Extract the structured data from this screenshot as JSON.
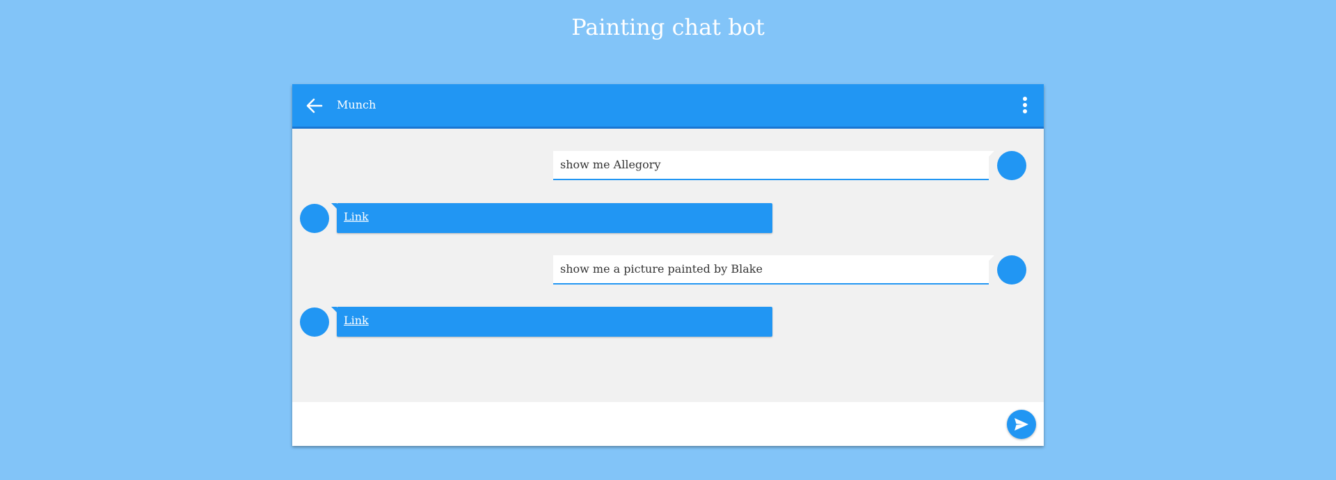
{
  "page": {
    "title": "Painting chat bot"
  },
  "header": {
    "name": "Munch",
    "back_icon": "arrow-left-icon",
    "menu_icon": "more-vert-icon"
  },
  "messages": [
    {
      "from": "user",
      "text": "show me Allegory"
    },
    {
      "from": "bot",
      "link_label": "Link"
    },
    {
      "from": "user",
      "text": "show me a picture painted by Blake"
    },
    {
      "from": "bot",
      "link_label": "Link"
    }
  ],
  "composer": {
    "value": "",
    "placeholder": "",
    "send_icon": "send-icon"
  },
  "colors": {
    "background": "#82c4f8",
    "primary": "#2196f3",
    "primary_dark": "#1976d2",
    "chat_bg": "#f1f1f1"
  }
}
